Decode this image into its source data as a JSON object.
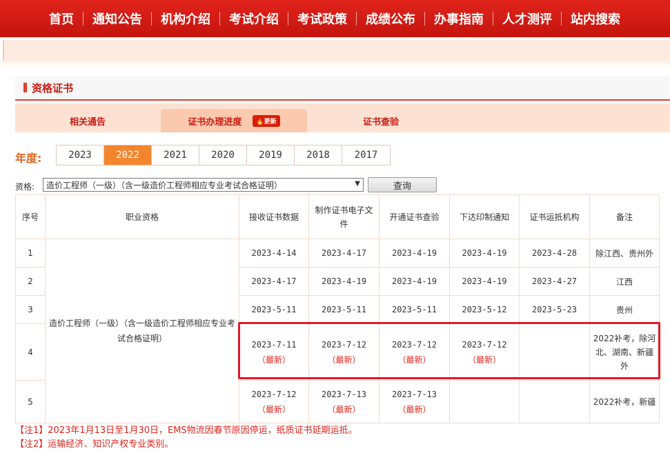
{
  "nav": [
    "首页",
    "通知公告",
    "机构介绍",
    "考试介绍",
    "考试政策",
    "成绩公布",
    "办事指南",
    "人才测评",
    "站内搜索"
  ],
  "section": {
    "title": "资格证书"
  },
  "tabs": {
    "t1": "相关通告",
    "t2": "证书办理进度",
    "t2_badge": "更新",
    "t3": "证书查验"
  },
  "year_label": "年度:",
  "years": [
    "2023",
    "2022",
    "2021",
    "2020",
    "2019",
    "2018",
    "2017"
  ],
  "active_year": "2022",
  "qual": {
    "label": "资格:",
    "selected": "造价工程师（一级）（含一级造价工程师相应专业考试合格证明）",
    "query": "查询"
  },
  "table": {
    "headers": [
      "序号",
      "职业资格",
      "接收证书数据",
      "制作证书电子文件",
      "开通证书查验",
      "下达印制通知",
      "证书运抵机构",
      "备注"
    ],
    "qualification": "造价工程师（一级）（含一级造价工程师相应专业考试合格证明）",
    "new_label": "（最新）",
    "rows": [
      {
        "no": "1",
        "c1": "2023-4-14",
        "c2": "2023-4-17",
        "c3": "2023-4-19",
        "c4": "2023-4-19",
        "c5": "2023-4-28",
        "note": "除江西、贵州外"
      },
      {
        "no": "2",
        "c1": "2023-4-17",
        "c2": "2023-4-19",
        "c3": "2023-4-19",
        "c4": "2023-4-19",
        "c5": "2023-4-27",
        "note": "江西"
      },
      {
        "no": "3",
        "c1": "2023-5-11",
        "c2": "2023-5-11",
        "c3": "2023-5-11",
        "c4": "2023-5-12",
        "c5": "2023-5-23",
        "note": "贵州"
      },
      {
        "no": "4",
        "c1": "2023-7-11",
        "c2": "2023-7-12",
        "c3": "2023-7-12",
        "c4": "2023-7-12",
        "c5": "",
        "note": "2022补考，除河北、湖南、新疆外"
      },
      {
        "no": "5",
        "c1": "2023-7-12",
        "c2": "2023-7-13",
        "c3": "2023-7-13",
        "c4": "",
        "c5": "",
        "note": "2022补考，新疆"
      }
    ]
  },
  "notes": [
    "【注1】2023年1月13日至1月30日，EMS物流因春节原因停运，纸质证书延期运抵。",
    "【注2】运输经济、知识产权专业类别。"
  ]
}
